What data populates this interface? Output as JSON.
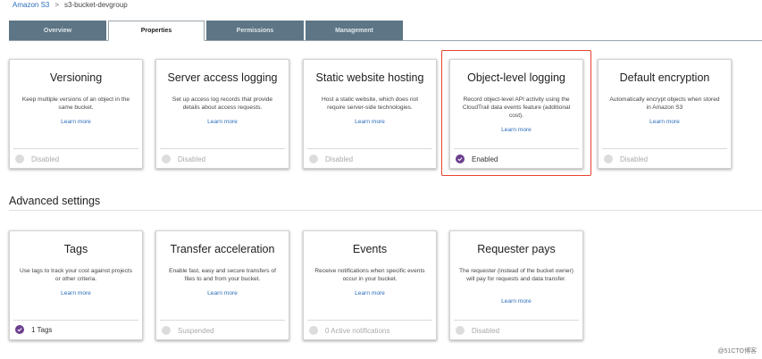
{
  "breadcrumb": {
    "root": "Amazon S3",
    "separator": ">",
    "current": "s3-bucket-devgroup"
  },
  "tabs": [
    {
      "label": "Overview",
      "active": false
    },
    {
      "label": "Properties",
      "active": true
    },
    {
      "label": "Permissions",
      "active": false
    },
    {
      "label": "Management",
      "active": false
    }
  ],
  "properties_cards": [
    {
      "title": "Versioning",
      "description": "Keep multiple versions of an object in the same bucket.",
      "link": "Learn more",
      "status": "Disabled",
      "enabled": false
    },
    {
      "title": "Server access logging",
      "description": "Set up access log records that provide details about access requests.",
      "link": "Learn more",
      "status": "Disabled",
      "enabled": false
    },
    {
      "title": "Static website hosting",
      "description": "Host a static website, which does not require server-side technologies.",
      "link": "Learn more",
      "status": "Disabled",
      "enabled": false
    },
    {
      "title": "Object-level logging",
      "description": "Record object-level API activity using the CloudTrail data events feature (additional cost).",
      "link": "Learn more",
      "status": "Enabled",
      "enabled": true
    },
    {
      "title": "Default encryption",
      "description": "Automatically encrypt objects when stored in Amazon S3",
      "link": "Learn more",
      "status": "Disabled",
      "enabled": false
    }
  ],
  "advanced_settings": {
    "title": "Advanced settings",
    "cards": [
      {
        "title": "Tags",
        "description": "Use tags to track your cost against projects or other criteria.",
        "link": "Learn more",
        "status": "1 Tags",
        "enabled": true
      },
      {
        "title": "Transfer acceleration",
        "description": "Enable fast, easy and secure transfers of files to and from your bucket.",
        "link": "Learn more",
        "status": "Suspended",
        "enabled": false
      },
      {
        "title": "Events",
        "description": "Receive notifications when specific events occur in your bucket.",
        "link": "Learn more",
        "status": "0 Active notifications",
        "enabled": false
      },
      {
        "title": "Requester pays",
        "description": "The requester (instead of the bucket owner) will pay for requests and data transfer.",
        "link": "Learn more",
        "status": "Disabled",
        "enabled": false
      }
    ]
  },
  "watermark": "@51CTO博客",
  "colors": {
    "tab_inactive": "#5d7585",
    "link": "#2a6ebb",
    "enabled_dot": "#6b3f8e",
    "highlight": "#e8432f"
  }
}
